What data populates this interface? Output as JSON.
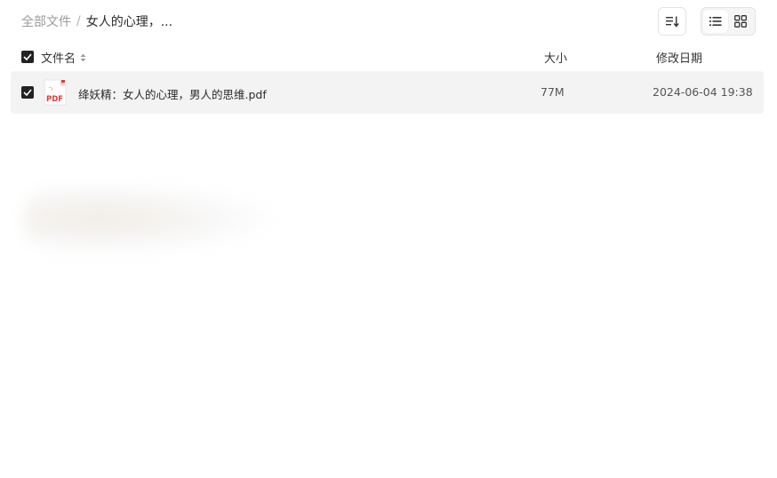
{
  "breadcrumb": {
    "root": "全部文件",
    "separator": "/",
    "current": "女人的心理，..."
  },
  "toolbar": {
    "sort_icon": "sort-list-icon",
    "list_view_icon": "list-view-icon",
    "grid_view_icon": "grid-view-icon",
    "active_view": "list"
  },
  "table": {
    "columns": {
      "name": "文件名",
      "size": "大小",
      "modified": "修改日期"
    },
    "rows": [
      {
        "name": "绛妖精：女人的心理，男人的思维.pdf",
        "size": "77M",
        "modified": "2024-06-04 19:38",
        "icon": "pdf-file-icon",
        "icon_label": "PDF",
        "checked": true
      }
    ]
  },
  "colors": {
    "checkbox": "#222222",
    "row_highlight": "#f3f3f3",
    "pdf_red": "#e53935"
  }
}
